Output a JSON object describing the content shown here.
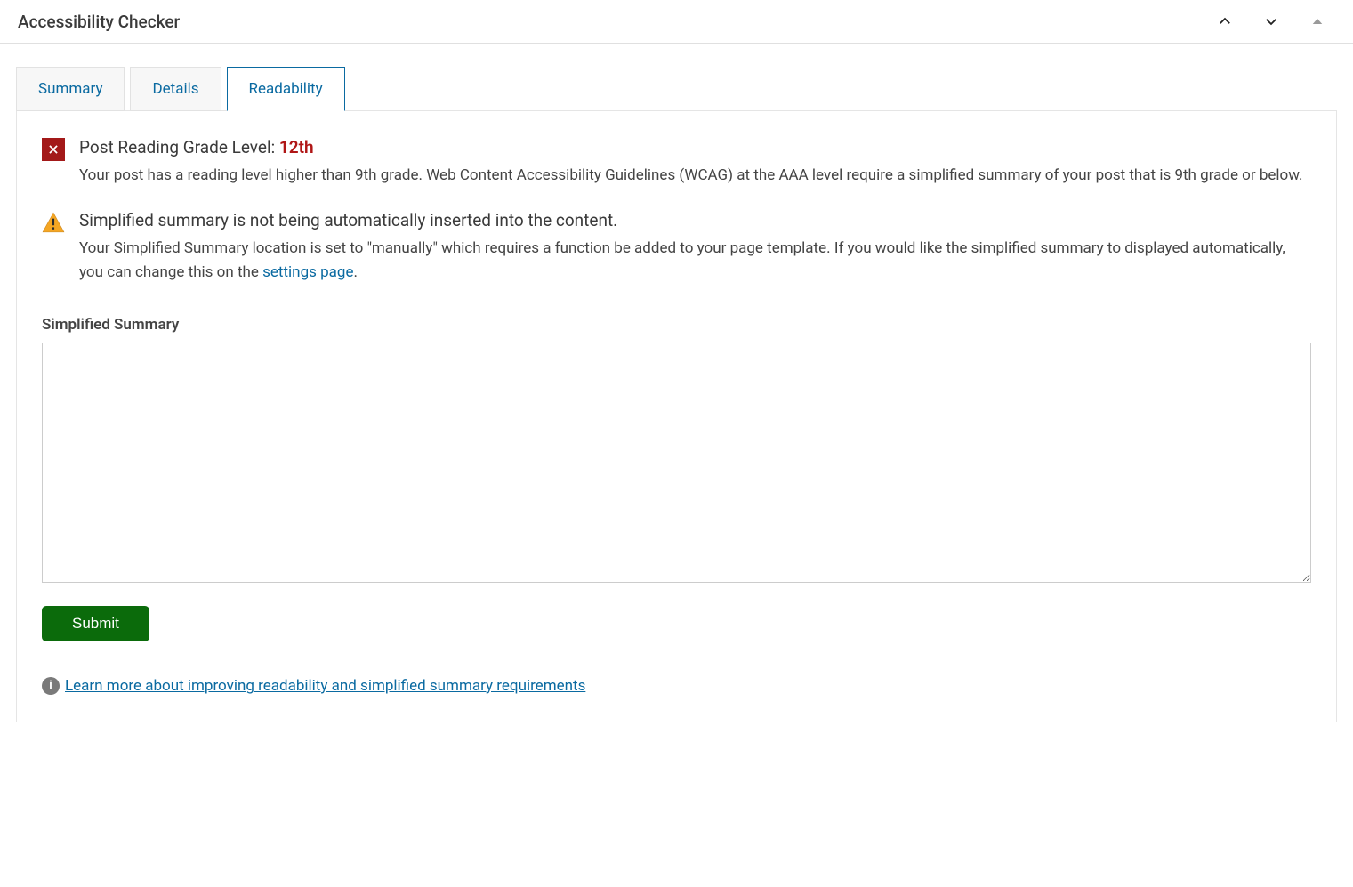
{
  "header": {
    "title": "Accessibility Checker"
  },
  "tabs": {
    "summary": "Summary",
    "details": "Details",
    "readability": "Readability"
  },
  "readability": {
    "gradeNotice": {
      "titlePrefix": "Post Reading Grade Level: ",
      "level": "12th",
      "body": "Your post has a reading level higher than 9th grade. Web Content Accessibility Guidelines (WCAG) at the AAA level require a simplified summary of your post that is 9th grade or below."
    },
    "insertionNotice": {
      "title": "Simplified summary is not being automatically inserted into the content.",
      "bodyBefore": "Your Simplified Summary location is set to \"manually\" which requires a function be added to your page template. If you would like the simplified summary to displayed automatically, you can change this on the ",
      "linkText": "settings page",
      "bodyAfter": "."
    },
    "summaryLabel": "Simplified Summary",
    "summaryValue": "",
    "submitLabel": "Submit",
    "learnMore": "Learn more about improving readability and simplified summary requirements"
  }
}
